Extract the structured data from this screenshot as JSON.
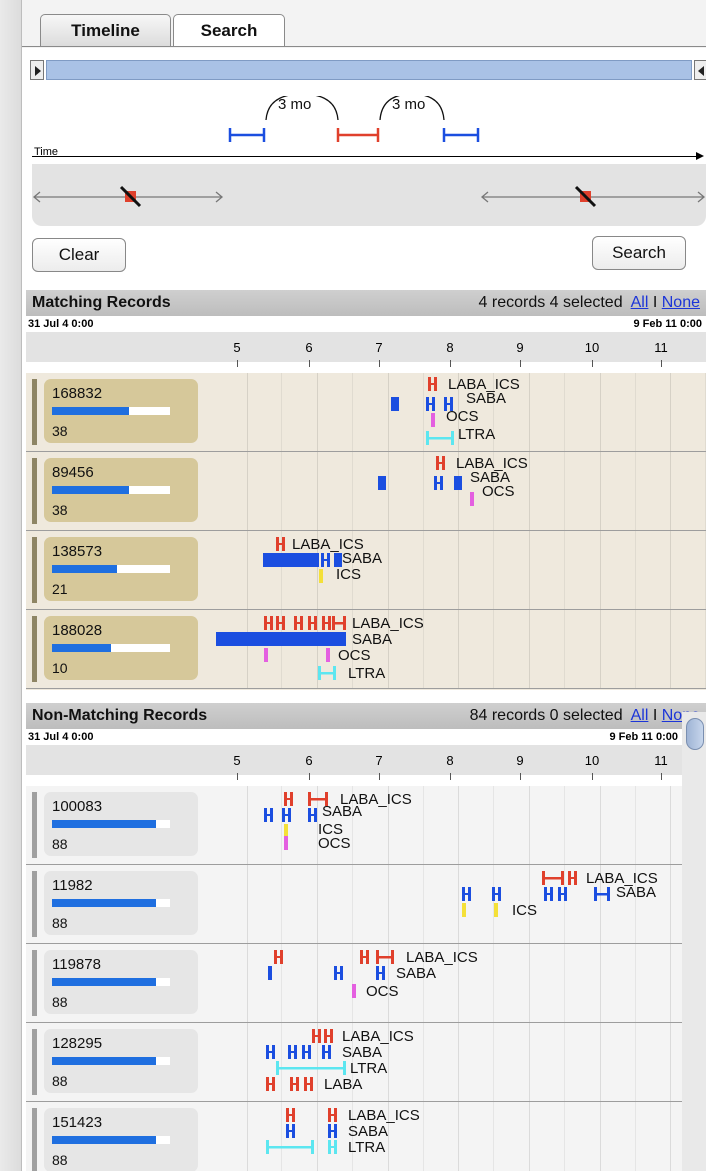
{
  "tabs": [
    {
      "label": "Timeline"
    },
    {
      "label": "Search"
    }
  ],
  "query": {
    "time_label": "Time",
    "gap1": "3 mo",
    "gap2": "3 mo",
    "clear_label": "Clear",
    "search_label": "Search"
  },
  "matching": {
    "title": "Matching Records",
    "count_text": "4 records 4 selected",
    "all_label": "All",
    "sep": "I",
    "none_label": "None",
    "date_start": "31 Jul 4 0:00",
    "date_end": "9 Feb 11 0:00",
    "ticks": [
      "5",
      "6",
      "7",
      "8",
      "9",
      "10",
      "11"
    ],
    "records": [
      {
        "id": "168832",
        "num": "38",
        "progress": 0.65,
        "labels": [
          "LABA_ICS",
          "SABA",
          "OCS",
          "LTRA"
        ]
      },
      {
        "id": "89456",
        "num": "38",
        "progress": 0.65,
        "labels": [
          "LABA_ICS",
          "SABA",
          "OCS"
        ]
      },
      {
        "id": "138573",
        "num": "21",
        "progress": 0.55,
        "labels": [
          "LABA_ICS",
          "SABA",
          "ICS"
        ]
      },
      {
        "id": "188028",
        "num": "10",
        "progress": 0.5,
        "labels": [
          "LABA_ICS",
          "SABA",
          "OCS",
          "LTRA"
        ]
      }
    ]
  },
  "nonmatching": {
    "title": "Non-Matching Records",
    "count_text": "84 records 0 selected",
    "all_label": "All",
    "sep": "I",
    "none_label": "None",
    "date_start": "31 Jul 4 0:00",
    "date_end": "9 Feb 11 0:00",
    "ticks": [
      "5",
      "6",
      "7",
      "8",
      "9",
      "10",
      "11"
    ],
    "records": [
      {
        "id": "100083",
        "num": "88",
        "progress": 0.88,
        "labels": [
          "LABA_ICS",
          "SABA",
          "ICS",
          "OCS"
        ]
      },
      {
        "id": "11982",
        "num": "88",
        "progress": 0.88,
        "labels": [
          "LABA_ICS",
          "SABA",
          "ICS"
        ]
      },
      {
        "id": "119878",
        "num": "88",
        "progress": 0.88,
        "labels": [
          "LABA_ICS",
          "SABA",
          "OCS"
        ]
      },
      {
        "id": "128295",
        "num": "88",
        "progress": 0.88,
        "labels": [
          "LABA_ICS",
          "SABA",
          "LTRA",
          "LABA"
        ]
      },
      {
        "id": "151423",
        "num": "88",
        "progress": 0.88,
        "labels": [
          "LABA_ICS",
          "SABA",
          "LTRA"
        ]
      }
    ]
  },
  "colors": {
    "red": "#e0402c",
    "blue": "#1b4ee0",
    "magenta": "#e45fe0",
    "cyan": "#5ce6f0",
    "yellow": "#f4e038",
    "match_card": "#d6c89a",
    "match_bg": "#efe9dd",
    "non_card": "#e6e6e6",
    "non_bg": "#f4f4f4"
  }
}
